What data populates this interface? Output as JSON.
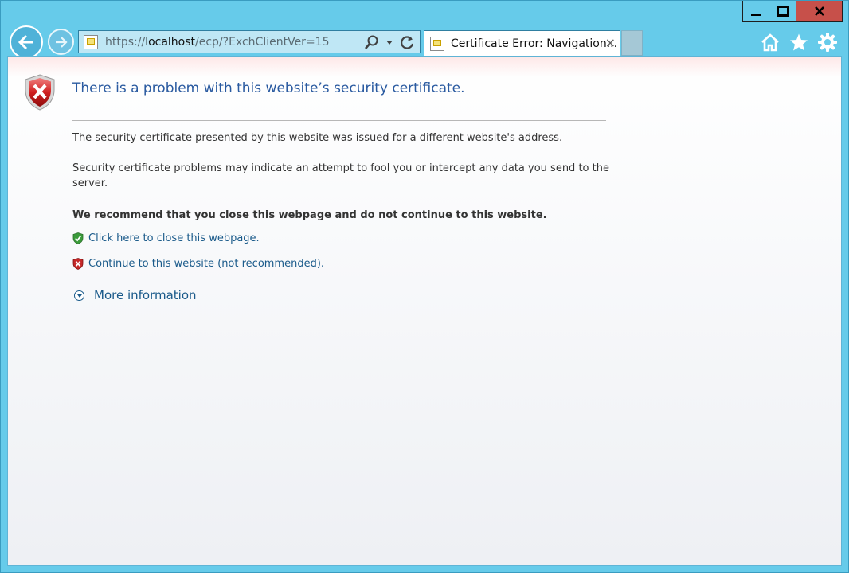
{
  "window": {
    "controls": [
      "minimize",
      "maximize",
      "close"
    ],
    "colors": {
      "frame": "#66cbea",
      "close_button": "#c7504a",
      "link": "#1a5a8a",
      "heading": "#2a5aa0"
    }
  },
  "address_bar": {
    "url_prefix": "https://",
    "url_host": "localhost",
    "url_path": "/ecp/?ExchClientVer=15"
  },
  "tab": {
    "title": "Certificate Error: Navigation...",
    "close_label": "×"
  },
  "page": {
    "heading": "There is a problem with this website’s security certificate.",
    "para1": "The security certificate presented by this website was issued for a different website's address.",
    "para2": "Security certificate problems may indicate an attempt to fool you or intercept any data you send to the server.",
    "recommendation": "We recommend that you close this webpage and do not continue to this website.",
    "close_link": "Click here to close this webpage.",
    "continue_link": "Continue to this website (not recommended).",
    "more_info": "More information"
  },
  "icons": {
    "nav": [
      "back-arrow-icon",
      "forward-arrow-icon"
    ],
    "address": [
      "search-icon",
      "dropdown-icon",
      "refresh-icon"
    ],
    "tools": [
      "home-icon",
      "favorites-star-icon",
      "settings-gear-icon"
    ],
    "page": [
      "red-shield-x-icon",
      "green-shield-check-icon",
      "red-shield-x-small-icon",
      "expand-circle-icon"
    ]
  }
}
